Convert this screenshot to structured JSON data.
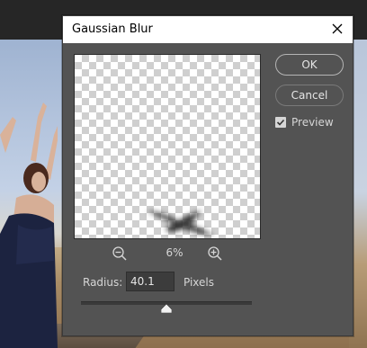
{
  "dialog": {
    "title": "Gaussian Blur",
    "zoom_level": "6%",
    "radius": {
      "label": "Radius:",
      "value": "40.1",
      "unit": "Pixels",
      "slider_fraction": 0.5
    },
    "buttons": {
      "ok": "OK",
      "cancel": "Cancel"
    },
    "preview": {
      "label": "Preview",
      "checked": true
    }
  },
  "icons": {
    "close": "close-icon",
    "zoom_out": "zoom-out-icon",
    "zoom_in": "zoom-in-icon",
    "check": "checkmark-icon"
  },
  "colors": {
    "dialog_bg": "#535353",
    "titlebar_bg": "#ffffff",
    "text": "#d6d6d6"
  }
}
